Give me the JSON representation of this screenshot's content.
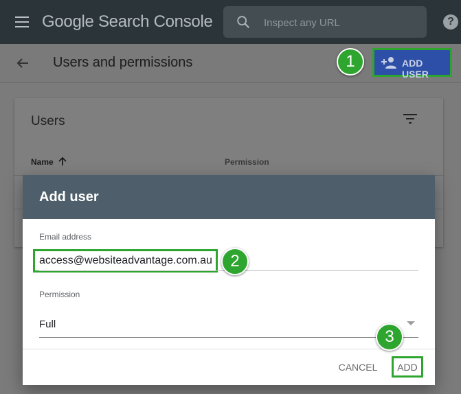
{
  "app": {
    "title": "Google Search Console"
  },
  "search": {
    "placeholder": "Inspect any URL"
  },
  "header": {
    "page_title": "Users and permissions",
    "add_user_label": "ADD USER"
  },
  "steps": [
    "1",
    "2",
    "3"
  ],
  "users_card": {
    "title": "Users",
    "columns": {
      "name": "Name",
      "permission": "Permission"
    }
  },
  "dialog": {
    "title": "Add user",
    "email_label": "Email address",
    "email_value": "access@websiteadvantage.com.au",
    "permission_label": "Permission",
    "permission_value": "Full",
    "cancel_label": "CANCEL",
    "add_label": "ADD"
  },
  "colors": {
    "highlight": "#2ea52f",
    "primary": "#2d4fa8",
    "dialog_header": "#4e5f6b"
  }
}
